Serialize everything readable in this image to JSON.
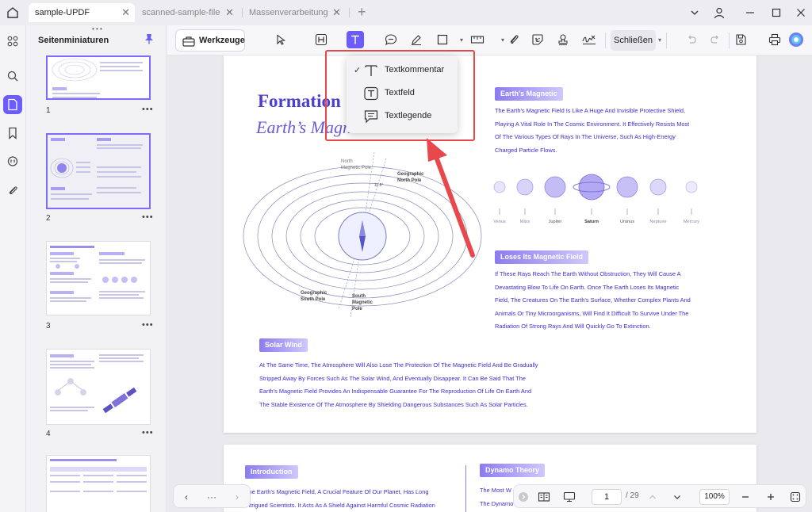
{
  "tabs": [
    {
      "label": "sample-UPDF",
      "active": true
    },
    {
      "label": "scanned-sample-file",
      "active": false
    },
    {
      "label": "Massenverarbeitung",
      "active": false
    }
  ],
  "sidebar": {
    "title": "Seitenminiaturen",
    "more_dots": "• • •",
    "thumbnails": [
      {
        "page": "1",
        "more": "•••"
      },
      {
        "page": "2",
        "more": "•••"
      },
      {
        "page": "3",
        "more": "•••"
      },
      {
        "page": "4",
        "more": "•••"
      }
    ]
  },
  "toolbar": {
    "tools_label": "Werkzeuge",
    "close_label": "Schließen"
  },
  "text_menu": {
    "items": [
      {
        "label": "Textkommentar",
        "checked": true
      },
      {
        "label": "Textfeld",
        "checked": false
      },
      {
        "label": "Textlegende",
        "checked": false
      }
    ],
    "check_mark": "✓"
  },
  "document": {
    "title": "Formation",
    "subtitle": "Earth’s Magn",
    "section_earth": {
      "badge": "Earth's Magnetic",
      "lines": [
        "The Earth's Magnetic Field Is Like A Huge And Invisible Protective Shield,",
        "Playing A Vital Role In The Cosmic Environment. It Effectively Resists Most",
        "Of The Various Types Of Rays In The Universe, Such As High-Energy",
        "Charged Particle Flows."
      ]
    },
    "planets": [
      "Venus",
      "Mars",
      "Jupiter",
      "Saturn",
      "Uranus",
      "Neptune",
      "Mercury"
    ],
    "section_loses": {
      "badge": "Loses Its Magnetic Field",
      "lines": [
        "If These Rays Reach The Earth Without Obstruction, They Will Cause A",
        "Devastating Blow To Life On Earth. Once The Earth Loses Its Magnetic",
        "Field, The Creatures On The Earth's Surface, Whether Complex Plants And",
        "Animals Or Tiny Microorganisms, Will Find It Difficult To Survive Under The",
        "Radiation Of Strong Rays And Will Quickly Go To Extinction."
      ]
    },
    "section_solar": {
      "badge": "Solar Wind",
      "lines": [
        "At The Same Time, The Atmosphere Will Also Lose The Protection Of The Magnetic Field And Be Gradually",
        "Stripped Away By Forces Such As The Solar Wind, And Eventually Disappear. It Can Be Said That The",
        "Earth's Magnetic Field Provides An Indispensable Guarantee For The Reproduction Of Life On Earth And",
        "The Stable Existence Of The Atmosphere By Shielding Dangerous Substances Such As Solar Particles."
      ]
    },
    "diagram_labels": {
      "north_magnetic": "North\nMagnetic Pole",
      "geo_north": "Geographic\nNorth Pole",
      "geo_south": "Geographic\nSouth Pole",
      "south_magnetic": "South\nMagnetic\nPole",
      "angle": "11.5°"
    }
  },
  "page2": {
    "intro_badge": "Introduction",
    "intro_lines": [
      "The Earth's Magnetic Field, A Crucial Feature Of Our Planet, Has Long",
      "Intrigued Scientists. It Acts As A Shield Against Harmful Cosmic Radiation"
    ],
    "dynamo_badge": "Dynamo Theory",
    "dynamo_lines": [
      "The Most W",
      "The Dynamo"
    ]
  },
  "bottom_nav": {
    "more": "···",
    "current_page": "1",
    "total_pages": "/ 29",
    "zoom": "100%"
  },
  "colors": {
    "accent": "#6a5cff",
    "doc_blue": "#3b2fd0",
    "annotation_red": "#e8474c"
  }
}
